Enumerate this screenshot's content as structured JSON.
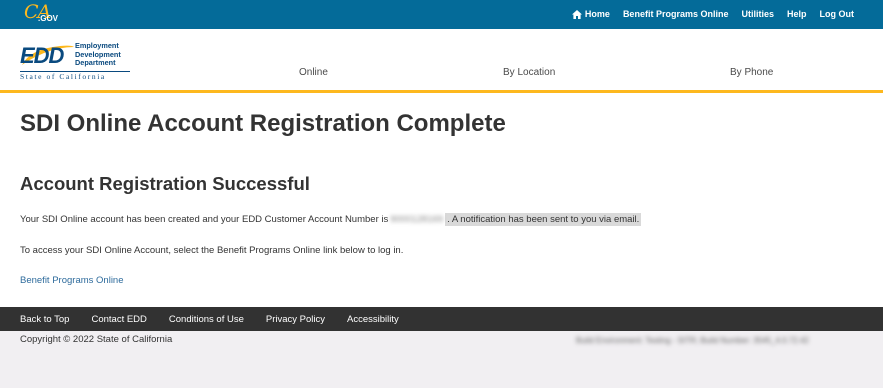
{
  "topbar": {
    "logo": {
      "ca": "CA",
      "gov": ".GOV"
    },
    "links": [
      "Home",
      "Benefit Programs Online",
      "Utilities",
      "Help",
      "Log Out"
    ]
  },
  "header": {
    "logo": {
      "letters": "EDD",
      "words": [
        "Employment",
        "Development",
        "Department"
      ],
      "state": "State of California"
    },
    "nav": [
      "Online",
      "By Location",
      "By Phone"
    ]
  },
  "main": {
    "title": "SDI Online Account Registration Complete",
    "section_title": "Account Registration Successful",
    "message_pre": "Your SDI Online account has been created and your EDD Customer Account Number is",
    "account_number_redacted": "9000128169",
    "message_highlight": ". A notification has been sent to you via email.",
    "instructions": "To access your SDI Online Account, select the Benefit Programs Online link below to log in.",
    "link": "Benefit Programs Online"
  },
  "footer": {
    "links": [
      "Back to Top",
      "Contact EDD",
      "Conditions of Use",
      "Privacy Policy",
      "Accessibility"
    ],
    "copyright": "Copyright © 2022 State of California",
    "build_info_redacted": "Build Environment: Testing - SITR; Build Number: 3545_4.0.72.42"
  },
  "colors": {
    "topbar": "#046b99",
    "accent_gold": "#fdb81e",
    "footer_dark": "#323232",
    "link": "#2e6b9c"
  }
}
